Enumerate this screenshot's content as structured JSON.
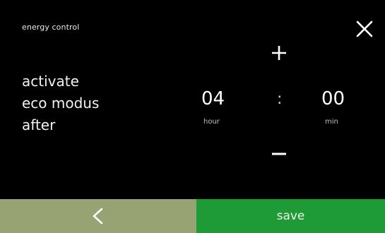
{
  "header": {
    "title": "energy control"
  },
  "description": {
    "line1": "activate",
    "line2": "eco modus",
    "line3": "after"
  },
  "timer": {
    "hours": "04",
    "separator": ":",
    "minutes": "00",
    "hour_label": "hour",
    "minute_label": "min"
  },
  "footer": {
    "save_label": "save"
  },
  "icons": {
    "close": "close-icon",
    "increase": "plus-icon",
    "decrease": "minus-icon",
    "back": "chevron-left-icon"
  },
  "colors": {
    "background": "#000000",
    "back_button": "#98a373",
    "save_button": "#1e9b36",
    "text": "#ffffff"
  }
}
